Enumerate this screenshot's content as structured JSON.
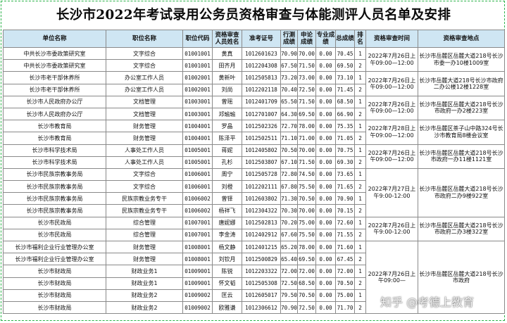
{
  "title": "长沙市2022年考试录用公务员资格审查与体能测评人员名单及安排",
  "headers": {
    "unit": "单位名称",
    "position": "职位名称",
    "code": "职位代码",
    "name": "资格审查人员姓名",
    "ticket": "准考证号",
    "xingce": "行测成绩",
    "shenlun": "申论成绩",
    "major": "专业成绩",
    "total": "总成绩",
    "rank": "排名",
    "time": "资格审查时间",
    "place": "资格审查地点"
  },
  "rows": [
    [
      "中共长沙市委政策研究室",
      "文字综合",
      "01001001",
      "黄真",
      "1012601623",
      "70.90",
      "70.00",
      "0.00",
      "70.45",
      "1"
    ],
    [
      "中共长沙市委政策研究室",
      "文字综合",
      "01001001",
      "田齐月",
      "1012204308",
      "67.50",
      "71.50",
      "0.00",
      "69.50",
      "2"
    ],
    [
      "长沙市老干部休养所",
      "办公室工作人员",
      "01002001",
      "黄新叶",
      "1012505813",
      "73.20",
      "73.00",
      "0.00",
      "73.10",
      "1"
    ],
    [
      "长沙市老干部休养所",
      "办公室工作人员",
      "01002001",
      "刘尚",
      "1012202118",
      "70.40",
      "72.50",
      "0.00",
      "71.45",
      "2"
    ],
    [
      "长沙市人民政府办公厅",
      "文档管理",
      "01003001",
      "曾瑶",
      "1012401709",
      "65.50",
      "71.50",
      "0.00",
      "68.50",
      "1"
    ],
    [
      "长沙市人民政府办公厅",
      "文档管理",
      "01003001",
      "邓瑜瑜",
      "1012701007",
      "64.30",
      "69.50",
      "0.00",
      "66.90",
      "2"
    ],
    [
      "长沙市教育局",
      "财务管理",
      "01004001",
      "罗晶",
      "1012502326",
      "72.70",
      "78.00",
      "0.00",
      "75.35",
      "1"
    ],
    [
      "长沙市教育局",
      "财务管理",
      "01004001",
      "陈泽平",
      "1012502511",
      "71.10",
      "71.00",
      "0.00",
      "71.05",
      "2"
    ],
    [
      "长沙市科学技术局",
      "人事处工作人员",
      "01005001",
      "蒋妮",
      "1012405802",
      "70.50",
      "70.00",
      "0.00",
      "70.75",
      "1"
    ],
    [
      "长沙市科学技术局",
      "人事处工作人员",
      "01005001",
      "孔杉",
      "1012503807",
      "67.10",
      "71.50",
      "0.00",
      "69.30",
      "2"
    ],
    [
      "长沙市民族宗教事务局",
      "文字综合",
      "01006001",
      "周宁",
      "1012505728",
      "72.80",
      "74.50",
      "0.00",
      "73.65",
      "1"
    ],
    [
      "长沙市民族宗教事务局",
      "文字综合",
      "01006001",
      "刘橙",
      "1012202111",
      "67.80",
      "75.50",
      "0.00",
      "71.65",
      "2"
    ],
    [
      "长沙市民族宗教事务局",
      "民族宗教业务专干",
      "01006002",
      "曾铎",
      "1012603802",
      "71.30",
      "70.50",
      "0.00",
      "70.90",
      "1"
    ],
    [
      "长沙市民族宗教事务局",
      "民族宗教业务专干",
      "01006002",
      "杨祥飞",
      "1012304322",
      "70.30",
      "70.00",
      "0.00",
      "70.15",
      "2"
    ],
    [
      "长沙市民政局",
      "综合管理",
      "01007001",
      "唐妮娜",
      "1012502813",
      "70.20",
      "75.00",
      "0.00",
      "72.60",
      "1"
    ],
    [
      "长沙市民政局",
      "综合管理",
      "01007001",
      "李金涛",
      "1012402912",
      "67.60",
      "75.50",
      "0.00",
      "71.55",
      "2"
    ],
    [
      "长沙市福利企业行业管理办公室",
      "财务管理",
      "01008001",
      "杨文静",
      "1012401215",
      "65.20",
      "78.00",
      "0.00",
      "71.60",
      "1"
    ],
    [
      "长沙市福利企业行业管理办公室",
      "财务管理",
      "01008001",
      "刘钦月",
      "1012500829",
      "65.40",
      "69.50",
      "0.00",
      "67.45",
      "2"
    ],
    [
      "长沙市财政局",
      "财政业务1",
      "01009001",
      "陈锐",
      "1012203322",
      "72.00",
      "72.00",
      "0.00",
      "72.00",
      "1"
    ],
    [
      "长沙市财政局",
      "财政业务1",
      "01009001",
      "怀文韬",
      "1012505308",
      "72.50",
      "68.50",
      "0.00",
      "70.50",
      "2"
    ],
    [
      "长沙市财政局",
      "财政业务2",
      "01009002",
      "匡云",
      "1012605017",
      "79.50",
      "70.50",
      "0.00",
      "75.00",
      "1"
    ],
    [
      "长沙市财政局",
      "财政业务2",
      "01009002",
      "欧雅谦",
      "1012306612",
      "70.90",
      "72.50",
      "0.00",
      "71.70",
      "2"
    ]
  ],
  "merged": [
    {
      "time": "2022年7月26日上午09:00—12:00",
      "place": "长沙市岳麓区岳麓大道218号长沙市委一办10楼1009室"
    },
    {
      "time": "2022年7月26日上午09:00—12:00",
      "place": "长沙市岳麓大道218号长沙市政府二办公楼12楼1228室"
    },
    {
      "time": "2022年7月26日上午09:00—12:00",
      "place": "长沙市岳麓区岳麓大道218号长沙市政府一办2楼223室"
    },
    {
      "time": "2022年7月28日上午09:00—12:00",
      "place": "长沙市岳麓区茶子山中路324号长沙市教育局8楼会议室"
    },
    {
      "time": "2022年7月26日上午09:00—12:00",
      "place": "长沙市岳麓区岳麓大道218号长沙市政府一办11楼1121室"
    },
    {
      "time": "2022年7月27日上午9:00-12:00",
      "place": "长沙市岳麓区岳麓大道218号长沙市政府二办9楼922室"
    },
    {
      "time": "2022年7月26日上午9:00-12:00",
      "place": "长沙市岳麓区岳麓大道218号长沙市政府二办3楼322室"
    },
    {
      "time": "2022年7月26日上午09:00—",
      "place": "长沙市岳麓区岳麓大道218号长沙市政府"
    }
  ],
  "watermark": "知乎 @考德上教育"
}
